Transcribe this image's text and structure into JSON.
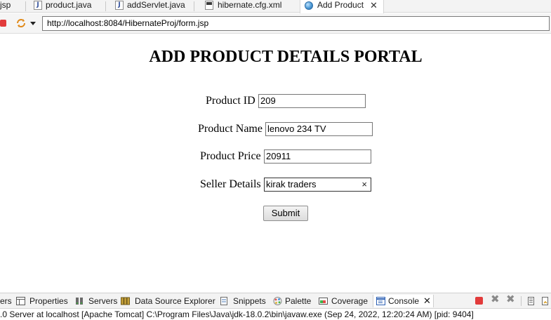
{
  "editor_tabs": [
    {
      "label": "jsp"
    },
    {
      "label": "product.java",
      "icon": "java-file-icon"
    },
    {
      "label": "addServlet.java",
      "icon": "java-file-icon"
    },
    {
      "label": "hibernate.cfg.xml",
      "icon": "xml-file-icon"
    },
    {
      "label": "Add Product",
      "icon": "globe-icon",
      "active": true
    }
  ],
  "browser": {
    "url": "http://localhost:8084/HibernateProj/form.jsp"
  },
  "form": {
    "heading": "ADD PRODUCT DETAILS PORTAL",
    "fields": [
      {
        "label": "Product ID",
        "value": "209"
      },
      {
        "label": "Product Name",
        "value": "lenovo 234 TV"
      },
      {
        "label": "Product Price",
        "value": "20911"
      },
      {
        "label": "Seller Details",
        "value": "kirak traders"
      }
    ],
    "clear_icon": "×",
    "submit_label": "Submit"
  },
  "views": [
    {
      "label": "ers"
    },
    {
      "label": "Properties",
      "icon": "properties-icon"
    },
    {
      "label": "Servers",
      "icon": "servers-icon"
    },
    {
      "label": "Data Source Explorer",
      "icon": "data-source-icon"
    },
    {
      "label": "Snippets",
      "icon": "snippets-icon"
    },
    {
      "label": "Palette",
      "icon": "palette-icon"
    },
    {
      "label": "Coverage",
      "icon": "coverage-icon"
    },
    {
      "label": "Console",
      "icon": "console-icon",
      "active": true
    }
  ],
  "console": {
    "status": ".0 Server at localhost [Apache Tomcat] C:\\Program Files\\Java\\jdk-18.0.2\\bin\\javaw.exe  (Sep 24, 2022, 12:20:24 AM) [pid: 9404]"
  },
  "colors": {
    "stop": "#e23b3b",
    "console_accent": "#2b5fb3"
  }
}
